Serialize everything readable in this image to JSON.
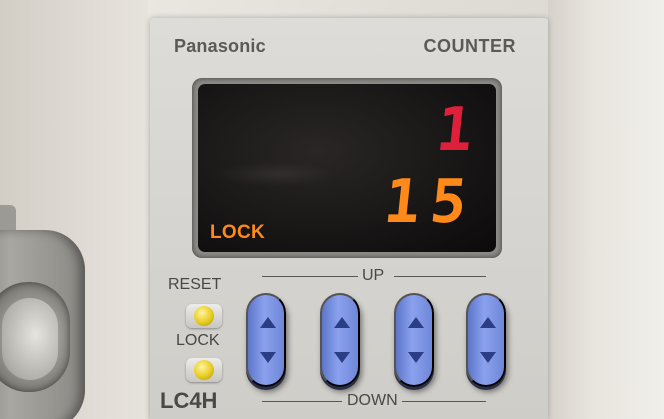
{
  "device": {
    "brand": "Panasonic",
    "title": "COUNTER",
    "series": "LC4H"
  },
  "display": {
    "upper_value": "1",
    "lower_value": "15",
    "indicator": "LOCK",
    "upper_color": "#e0203a",
    "lower_color": "#ff8a1a"
  },
  "controls": {
    "reset_label": "RESET",
    "lock_label": "LOCK",
    "up_label": "UP",
    "down_label": "DOWN",
    "digit_keys": [
      {
        "name": "digit-key-1"
      },
      {
        "name": "digit-key-2"
      },
      {
        "name": "digit-key-3"
      },
      {
        "name": "digit-key-4"
      }
    ],
    "key_color": "#7b93e0",
    "switch_color": "#e7cc1e"
  }
}
